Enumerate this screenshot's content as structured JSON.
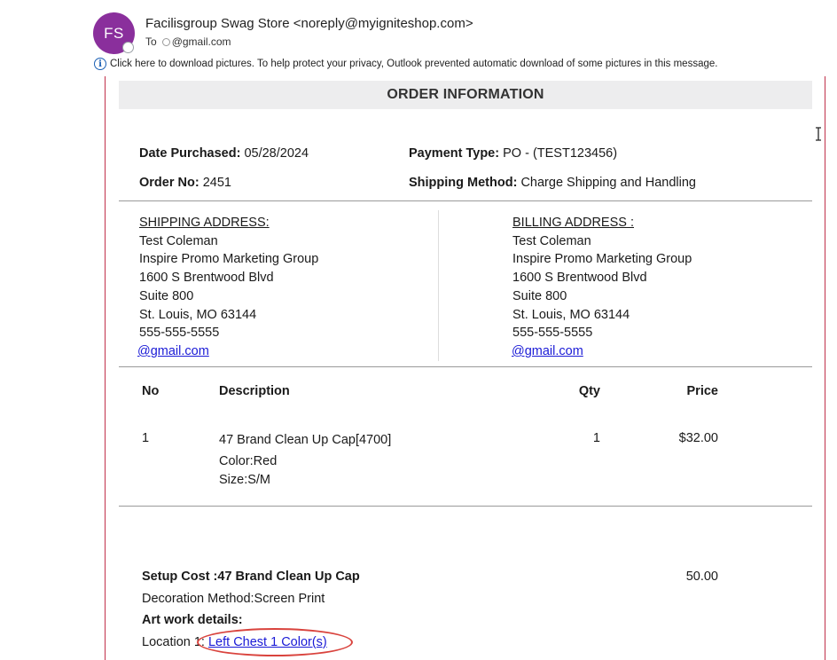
{
  "email": {
    "avatar_initials": "FS",
    "sender": "Facilisgroup Swag Store <noreply@myigniteshop.com>",
    "to_label": "To",
    "to_value": "@gmail.com",
    "privacy_notice": "Click here to download pictures. To help protect your privacy, Outlook prevented automatic download of some pictures in this message."
  },
  "order": {
    "header": "ORDER INFORMATION",
    "date_label": "Date Purchased:",
    "date_value": " 05/28/2024",
    "payment_label": "Payment Type:",
    "payment_value": " PO - (TEST123456)",
    "order_no_label": "Order No:",
    "order_no_value": " 2451",
    "shipping_method_label": "Shipping Method:",
    "shipping_method_value": " Charge Shipping and Handling"
  },
  "shipping_address": {
    "title": "SHIPPING ADDRESS:",
    "lines": [
      "Test Coleman",
      "Inspire Promo Marketing Group",
      "1600 S Brentwood Blvd",
      "Suite 800",
      "St. Louis, MO 63144",
      "555-555-5555"
    ],
    "email": "@gmail.com"
  },
  "billing_address": {
    "title": "BILLING ADDRESS :",
    "lines": [
      "Test Coleman",
      "Inspire Promo Marketing Group",
      "1600 S Brentwood Blvd",
      "Suite 800",
      "St. Louis, MO 63144",
      "555-555-5555"
    ],
    "email": "@gmail.com"
  },
  "items_table": {
    "headers": {
      "no": "No",
      "description": "Description",
      "qty": "Qty",
      "price": "Price"
    },
    "rows": [
      {
        "no": "1",
        "description": "47 Brand Clean Up Cap[4700]",
        "color": "Color:Red",
        "size": "Size:S/M",
        "qty": "1",
        "price": "$32.00"
      }
    ]
  },
  "setup": {
    "title": "Setup Cost :47 Brand Clean Up Cap",
    "cost": "50.00",
    "decoration": "Decoration Method:Screen Print",
    "artwork_title": "Art work details:",
    "location_label": "Location 1: ",
    "location_link": "Left Chest 1 Color(s)"
  },
  "colors": {
    "avatar": "#8a2f9c",
    "frame": "#c0304a",
    "link": "#1a1ad6",
    "highlight": "#d9433d"
  }
}
